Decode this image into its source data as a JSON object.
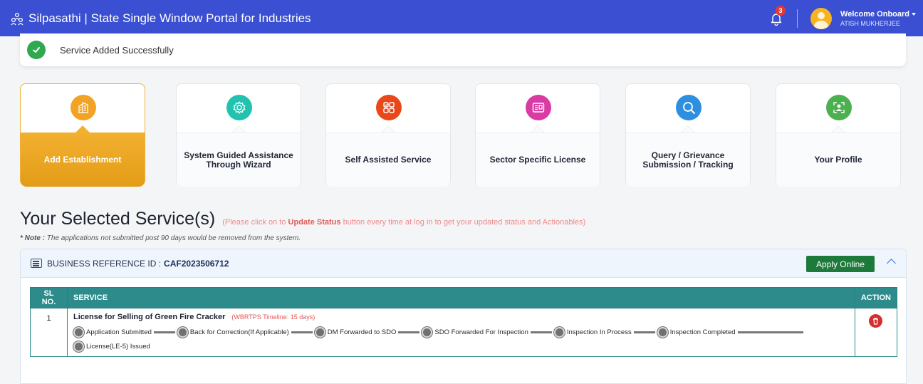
{
  "header": {
    "title": "Silpasathi | State Single Window Portal for Industries",
    "notification_count": "3",
    "welcome": "Welcome Onboard",
    "user_name": "ATISH MUKHERJEE"
  },
  "alert": {
    "message": "Service Added Successfully"
  },
  "cards": [
    {
      "label": "Add Establishment",
      "icon": "building-icon",
      "color": "#f2a324",
      "active": true
    },
    {
      "label": "System Guided Assistance Through Wizard",
      "icon": "gear-icon",
      "color": "#1fc3b0"
    },
    {
      "label": "Self Assisted Service",
      "icon": "grid-checklist-icon",
      "color": "#e9481b"
    },
    {
      "label": "Sector Specific License",
      "icon": "license-icon",
      "color": "#d93aa3"
    },
    {
      "label": "Query / Grievance Submission / Tracking",
      "icon": "search-icon",
      "color": "#2e8fe0"
    },
    {
      "label": "Your Profile",
      "icon": "profile-icon",
      "color": "#4caf50"
    }
  ],
  "section": {
    "title": "Your Selected Service(s)",
    "hint_pre": "(Please click on to ",
    "hint_bold": "Update Status",
    "hint_post": " button every time at log in to get your updated status and Actionables)",
    "note_label": "* Note :",
    "note_text": " The applications not submitted post 90 days would be removed from the system."
  },
  "reference": {
    "label": "BUSINESS REFERENCE ID :",
    "id": "CAF2023506712",
    "apply_label": "Apply Online"
  },
  "table": {
    "headers": {
      "sl": "SL NO.",
      "service": "SERVICE",
      "action": "ACTION"
    },
    "rows": [
      {
        "sl": "1",
        "service": "License for Selling of Green Fire Cracker",
        "timeline": "(WBRTPS Timeline: 15 days)",
        "steps": [
          "Application Submitted",
          "Back for Correction(If Applicable)",
          "DM Forwarded to SDO",
          "SDO Forwarded For Inspection",
          "Inspection In Process",
          "Inspection Completed",
          "License(LE-5) Issued"
        ]
      }
    ]
  }
}
